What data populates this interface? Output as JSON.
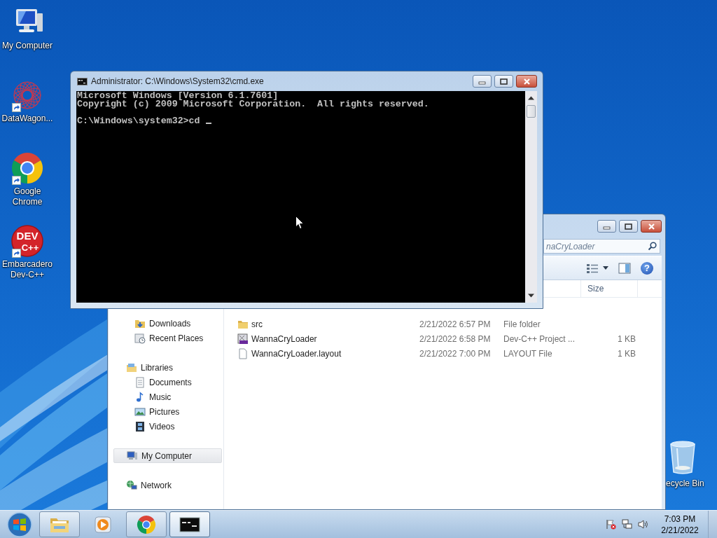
{
  "desktop_icons": [
    {
      "kind": "computer",
      "label": "My Computer",
      "shortcut": false
    },
    {
      "kind": "mesh-app",
      "label": "DataWagon...",
      "shortcut": true
    },
    {
      "kind": "chrome",
      "label": "Google Chrome",
      "shortcut": true
    },
    {
      "kind": "dev-cpp",
      "label": "Embarcadero Dev-C++",
      "shortcut": true,
      "logo_text": [
        "DEV",
        "C++"
      ]
    }
  ],
  "recycle_bin": {
    "label": "ecycle Bin"
  },
  "explorer": {
    "search": {
      "value": "naCryLoader"
    },
    "help": "?",
    "size_header": "Size",
    "navigation": [
      {
        "children": [
          {
            "kind": "downloads",
            "label": "Downloads",
            "selected": false
          },
          {
            "kind": "recent",
            "label": "Recent Places",
            "selected": false
          }
        ]
      },
      {
        "kind": "libraries",
        "label": "Libraries",
        "selected": false,
        "children": [
          {
            "kind": "documents",
            "label": "Documents",
            "selected": false
          },
          {
            "kind": "music",
            "label": "Music",
            "selected": false
          },
          {
            "kind": "pictures",
            "label": "Pictures",
            "selected": false
          },
          {
            "kind": "videos",
            "label": "Videos",
            "selected": false
          }
        ]
      },
      {
        "kind": "computer",
        "label": "My Computer",
        "selected": true
      },
      {
        "kind": "network",
        "label": "Network",
        "selected": false
      }
    ],
    "files": [
      {
        "kind": "folder",
        "name": "src",
        "date": "2/21/2022 6:57 PM",
        "type": "File folder"
      },
      {
        "kind": "dev-project",
        "name": "WannaCryLoader",
        "date": "2/21/2022 6:58 PM",
        "type": "Dev-C++ Project ...",
        "size": "1 KB"
      },
      {
        "kind": "file",
        "name": "WannaCryLoader.layout",
        "date": "2/21/2022 7:00 PM",
        "type": "LAYOUT File",
        "size": "1 KB"
      }
    ]
  },
  "cmd": {
    "title": "Administrator: C:\\Windows\\System32\\cmd.exe",
    "paragraphs": [
      [
        "Microsoft Windows [Version 6.1.7601]",
        "Copyright (c) 2009 Microsoft Corporation.  All rights reserved."
      ],
      [
        "C:\\Windows\\system32>cd"
      ]
    ],
    "cursor": true
  },
  "taskbar": {
    "buttons": [
      {
        "kind": "explorer",
        "running": true,
        "active": false
      },
      {
        "kind": "media-player",
        "running": false,
        "active": false
      },
      {
        "kind": "chrome",
        "running": true,
        "active": false
      },
      {
        "kind": "cmd",
        "running": true,
        "active": true
      }
    ],
    "tray": [
      {
        "kind": "flag-alert"
      },
      {
        "kind": "network"
      },
      {
        "kind": "volume"
      }
    ],
    "clock": {
      "time": "7:03 PM",
      "date": "2/21/2022"
    }
  }
}
